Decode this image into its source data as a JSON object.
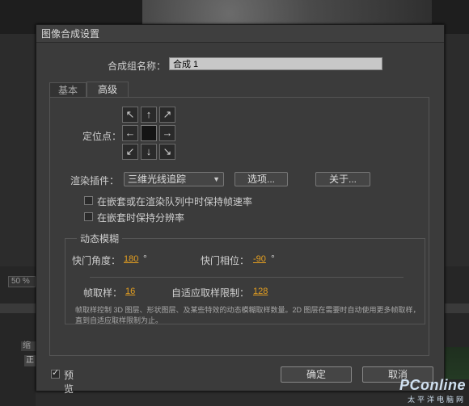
{
  "dialog": {
    "title": "图像合成设置",
    "name_label": "合成组名称：",
    "name_value": "合成 1",
    "tabs": [
      "基本",
      "高级"
    ],
    "anchor_label": "定位点：",
    "anchor_arrows": [
      "↖",
      "↑",
      "↗",
      "←",
      "",
      "→",
      "↙",
      "↓",
      "↘"
    ],
    "renderer_label": "渲染插件：",
    "renderer_value": "三维光线追踪",
    "options_button": "选项...",
    "about_button": "关于...",
    "checkbox1": "在嵌套或在渲染队列中时保持帧速率",
    "checkbox2": "在嵌套时保持分辨率",
    "motion_blur": {
      "title": "动态模糊",
      "shutter_angle_label": "快门角度：",
      "shutter_angle_value": "180",
      "shutter_angle_unit": "°",
      "shutter_phase_label": "快门相位：",
      "shutter_phase_value": "-90",
      "shutter_phase_unit": "°",
      "samples_label": "帧取样：",
      "samples_value": "16",
      "adaptive_label": "自适应取样限制：",
      "adaptive_value": "128",
      "note": "帧取样控制 3D 图层、形状图层、及某些特效的动态模糊取样数量。2D 图层在需要时自动使用更多帧取样，直到自适应取样限制为止。"
    },
    "preview_label": "预览",
    "ok_button": "确定",
    "cancel_button": "取消"
  },
  "background": {
    "zoom": "50 %",
    "cell1": "缩",
    "cell2": "正"
  },
  "watermark": {
    "brand": "PConline",
    "sub": "太平洋电脑网"
  }
}
